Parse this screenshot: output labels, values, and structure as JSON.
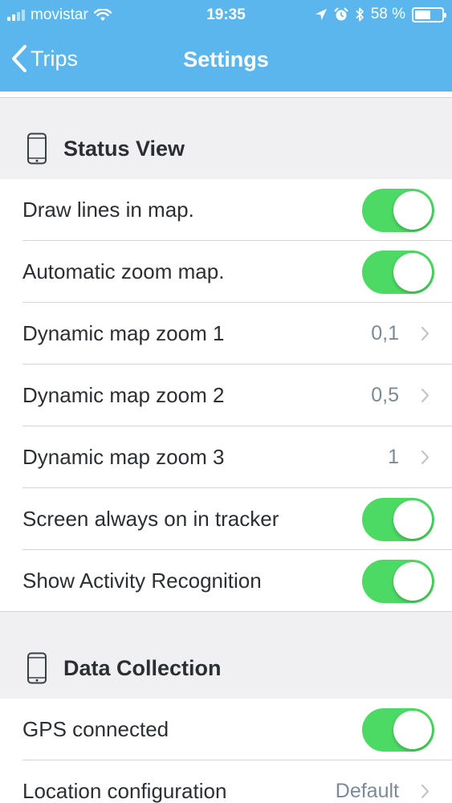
{
  "status_bar": {
    "carrier": "movistar",
    "time": "19:35",
    "battery_text": "58 %",
    "battery_level": 0.58
  },
  "nav": {
    "back_label": "Trips",
    "title": "Settings"
  },
  "sections": {
    "status_view": {
      "title": "Status View",
      "rows": [
        {
          "label": "Draw lines in map.",
          "type": "toggle",
          "on": true
        },
        {
          "label": "Automatic zoom map.",
          "type": "toggle",
          "on": true
        },
        {
          "label": "Dynamic map zoom 1",
          "type": "disclosure",
          "value": "0,1"
        },
        {
          "label": "Dynamic map zoom 2",
          "type": "disclosure",
          "value": "0,5"
        },
        {
          "label": "Dynamic map zoom 3",
          "type": "disclosure",
          "value": "1"
        },
        {
          "label": "Screen always on in tracker",
          "type": "toggle",
          "on": true
        },
        {
          "label": "Show Activity Recognition",
          "type": "toggle",
          "on": true
        }
      ]
    },
    "data_collection": {
      "title": "Data Collection",
      "rows": [
        {
          "label": "GPS connected",
          "type": "toggle",
          "on": true
        },
        {
          "label": "Location configuration",
          "type": "disclosure",
          "value": "Default"
        }
      ]
    }
  },
  "colors": {
    "header": "#5bb6ee",
    "toggle_on": "#4cd964",
    "background": "#f0f0f2"
  }
}
